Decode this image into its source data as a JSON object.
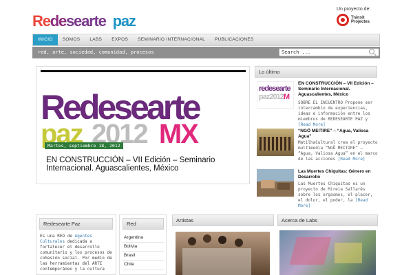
{
  "header": {
    "logo_part1": "Re",
    "logo_part2": "de",
    "logo_part3": "searte",
    "logo_part4": "paz",
    "project_label": "Un proyecto de:",
    "partner_name": "Tránsit Projectes"
  },
  "nav": {
    "items": [
      "INICIO",
      "SOMOS",
      "LABS",
      "EXPOS",
      "SEMINARIO INTERNACIONAL",
      "PUBLICACIONES"
    ],
    "active_index": 0
  },
  "subbar": {
    "tagline": "red, arte, sociedad, comunidad, procesos",
    "search_placeholder": "Search ..."
  },
  "feature": {
    "banner_line1": "Redesearte",
    "banner_line2_a": "paz",
    "banner_line2_b": "2012",
    "banner_line2_c": "MX",
    "date": "Martes, septiembre 18, 2012",
    "title": "EN CONSTRUCCIÓN – VII Edición – Seminario Internacional. Aguascalientes, México"
  },
  "latest": {
    "heading": "Lo último",
    "thumb_text_1": "redesearte",
    "thumb_text_2": "paz2012",
    "thumb_text_3": "M",
    "posts": [
      {
        "title": "EN CONSTRUCCIÓN – VII Edición – Seminario Internacional. Aguascalientes, México",
        "excerpt": "SOBRE EL ENCUENTRO Propone ser intercambio de experiencias, ideas e información entre los miembros de REDESEARTE PAZ y",
        "more": "[Read More]"
      },
      {
        "title": "“NGÖ MEITIRE” – “Agua, Valiosa Agua”",
        "excerpt": "MatilhaCultural crea el proyecto multimedia “NGÖ MEITIRE” – “Agua, Valiosa Agua” en el marco de las acciones",
        "more": "[Read More]"
      },
      {
        "title": "Las Muertes Chiquitas: Género en Desarrollo",
        "excerpt": "Las Muertes Chiquitas es un proyecto de Mireia Sallarés sobre los orgasmos, el placer, el dolor, el poder, la",
        "more": "[Read More]"
      }
    ]
  },
  "about": {
    "heading": "Redesearte Paz",
    "text_before": "Es una RED de ",
    "link": "Agentes Culturales",
    "text_after": " dedicada a fortalecer el desarrollo comunitario y los procesos de cohesión social. Por medio de las herramientas del ARTE contemporáneo y la cultura"
  },
  "red": {
    "heading": "Red",
    "items": [
      "Argentina",
      "Bolivia",
      "Brasil",
      "Chile"
    ]
  },
  "artistas": {
    "heading": "Artistas"
  },
  "labs": {
    "heading": "Acerca de Labs"
  },
  "colors": {
    "accent": "#2a9ec7",
    "date_badge": "#2d7a3a",
    "link": "#3b7fb3",
    "logo_red": "#e8463c",
    "logo_blue": "#1f94c7"
  }
}
